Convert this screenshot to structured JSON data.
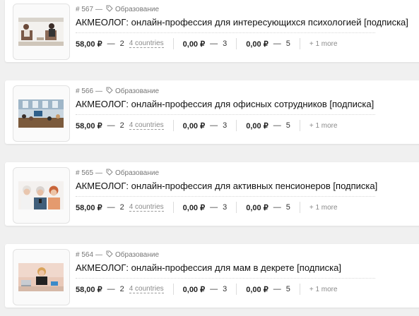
{
  "products": [
    {
      "id": "# 567",
      "dash": "—",
      "category": "Образование",
      "title": "АКМЕОЛОГ: онлайн-профессия для интересующихся психологией [подписка]",
      "image_icon": "therapy-session-photo",
      "tiers": [
        {
          "price": "58,00 ₽",
          "dash": "—",
          "qty": "2",
          "countries": "4 countries"
        },
        {
          "price": "0,00 ₽",
          "dash": "—",
          "qty": "3"
        },
        {
          "price": "0,00 ₽",
          "dash": "—",
          "qty": "5"
        }
      ],
      "more": "+ 1 more"
    },
    {
      "id": "# 566",
      "dash": "—",
      "category": "Образование",
      "title": "АКМЕОЛОГ: онлайн-профессия для офисных сотрудников [подписка]",
      "image_icon": "office-meeting-photo",
      "tiers": [
        {
          "price": "58,00 ₽",
          "dash": "—",
          "qty": "2",
          "countries": "4 countries"
        },
        {
          "price": "0,00 ₽",
          "dash": "—",
          "qty": "3"
        },
        {
          "price": "0,00 ₽",
          "dash": "—",
          "qty": "5"
        }
      ],
      "more": "+ 1 more"
    },
    {
      "id": "# 565",
      "dash": "—",
      "category": "Образование",
      "title": "АКМЕОЛОГ: онлайн-профессия для активных пенсионеров [подписка]",
      "image_icon": "senior-women-photo",
      "tiers": [
        {
          "price": "58,00 ₽",
          "dash": "—",
          "qty": "2",
          "countries": "4 countries"
        },
        {
          "price": "0,00 ₽",
          "dash": "—",
          "qty": "3"
        },
        {
          "price": "0,00 ₽",
          "dash": "—",
          "qty": "5"
        }
      ],
      "more": "+ 1 more"
    },
    {
      "id": "# 564",
      "dash": "—",
      "category": "Образование",
      "title": "АКМЕОЛОГ: онлайн-профессия для мам в декрете [подписка]",
      "image_icon": "mother-at-laptop-photo",
      "tiers": [
        {
          "price": "58,00 ₽",
          "dash": "—",
          "qty": "2",
          "countries": "4 countries"
        },
        {
          "price": "0,00 ₽",
          "dash": "—",
          "qty": "3"
        },
        {
          "price": "0,00 ₽",
          "dash": "—",
          "qty": "5"
        }
      ],
      "more": "+ 1 more"
    }
  ],
  "colors": {
    "background": "#f0f0f0",
    "card": "#ffffff",
    "muted_text": "#777777"
  }
}
